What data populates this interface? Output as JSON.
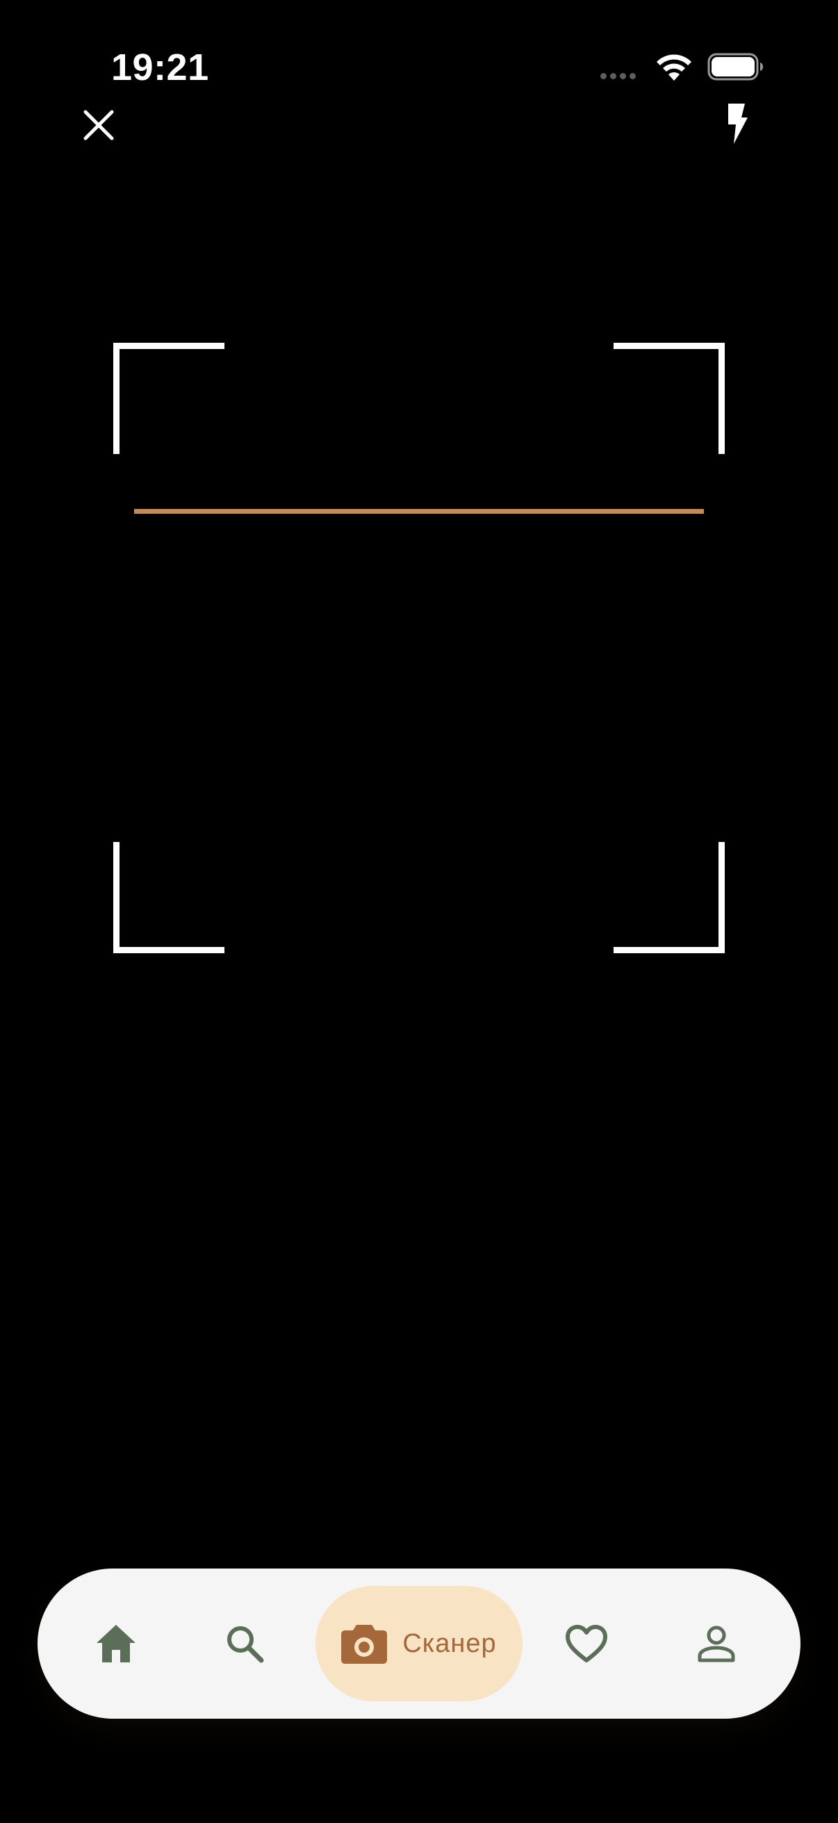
{
  "status_bar": {
    "time": "19:21"
  },
  "top_controls": {
    "close_icon": "close-icon",
    "flash_icon": "flash-icon"
  },
  "scanner": {
    "line_color": "#c48a57",
    "frame_color": "#ffffff"
  },
  "tab_bar": {
    "background": "#f5f5f5",
    "active_background": "#f8e3c5",
    "active_color": "#a4683a",
    "inactive_color": "#5b6e58",
    "items": [
      {
        "icon": "home-icon",
        "label": ""
      },
      {
        "icon": "search-icon",
        "label": ""
      },
      {
        "icon": "camera-icon",
        "label": "Сканер",
        "active": true
      },
      {
        "icon": "heart-icon",
        "label": ""
      },
      {
        "icon": "person-icon",
        "label": ""
      }
    ]
  }
}
